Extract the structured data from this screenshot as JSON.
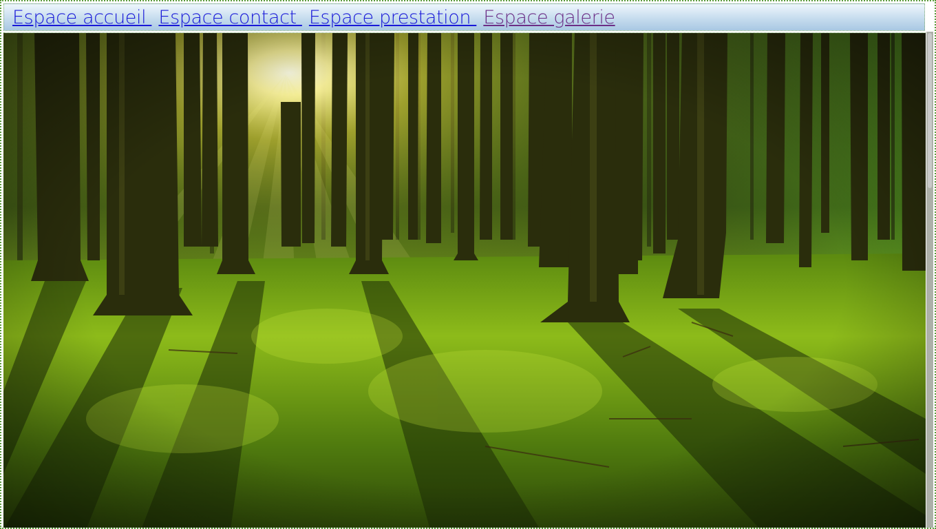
{
  "nav": {
    "items": [
      {
        "label": "Espace accueil ",
        "visited": false
      },
      {
        "label": "Espace contact ",
        "visited": false
      },
      {
        "label": "Espace prestation ",
        "visited": false
      },
      {
        "label": "Espace galerie",
        "visited": true
      }
    ]
  },
  "hero": {
    "image": "sunlit-forest-photo"
  },
  "colors": {
    "link": "#1818d8",
    "link_visited": "#6b2d86",
    "nav_bg_top": "#eef6fc",
    "nav_bg_bottom": "#a9c8e3"
  }
}
